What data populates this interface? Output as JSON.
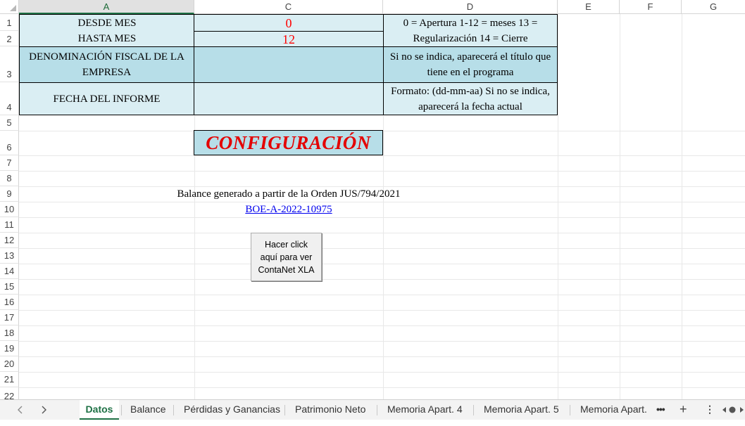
{
  "columns": [
    {
      "label": "A",
      "selected": true
    },
    {
      "label": "C",
      "selected": false
    },
    {
      "label": "D",
      "selected": false
    },
    {
      "label": "E",
      "selected": false
    },
    {
      "label": "F",
      "selected": false
    },
    {
      "label": "G",
      "selected": false
    }
  ],
  "rows": [
    "1",
    "2",
    "3",
    "4",
    "5",
    "6",
    "7",
    "8",
    "9",
    "10",
    "11",
    "12",
    "13",
    "14",
    "15",
    "16",
    "17",
    "18",
    "19",
    "20",
    "21",
    "22"
  ],
  "table": {
    "desde_label": "DESDE MES",
    "desde_value": "0",
    "hasta_label": "HASTA MES",
    "hasta_value": "12",
    "period_note": "0 = Apertura  1-12 = meses  13 = Regularización  14 = Cierre",
    "denominacion_label": "DENOMINACIÓN FISCAL DE LA EMPRESA",
    "denominacion_value": "",
    "denominacion_note": "Si no se indica, aparecerá el título que tiene en el programa",
    "fecha_label": "FECHA DEL INFORME",
    "fecha_value": "",
    "fecha_note": "Formato: (dd-mm-aa) Si no se indica, aparecerá la fecha actual"
  },
  "config_title": "CONFIGURACIÓN",
  "balance_text": "Balance generado a partir de la Orden JUS/794/2021",
  "boe_link": "BOE-A-2022-10975",
  "contanet_button": "Hacer click aquí para ver ContaNet XLA",
  "tabs": [
    {
      "label": "Datos",
      "active": true
    },
    {
      "label": "Balance",
      "active": false
    },
    {
      "label": "Pérdidas y Ganancias",
      "active": false
    },
    {
      "label": "Patrimonio Neto",
      "active": false
    },
    {
      "label": "Memoria Apart. 4",
      "active": false
    },
    {
      "label": "Memoria Apart. 5",
      "active": false
    },
    {
      "label": "Memoria Apart.",
      "active": false
    }
  ],
  "icons": {
    "prev": "chevron-left-icon",
    "next": "chevron-right-icon",
    "more": "ellipsis-icon",
    "add": "plus-icon",
    "options": "vertical-ellipsis-icon",
    "scroll": "scroll-arrows-icon"
  },
  "colors": {
    "accent": "#1e7145",
    "cell_light": "#daeef3",
    "cell_dark": "#b7dee8",
    "red": "#ff0000"
  }
}
